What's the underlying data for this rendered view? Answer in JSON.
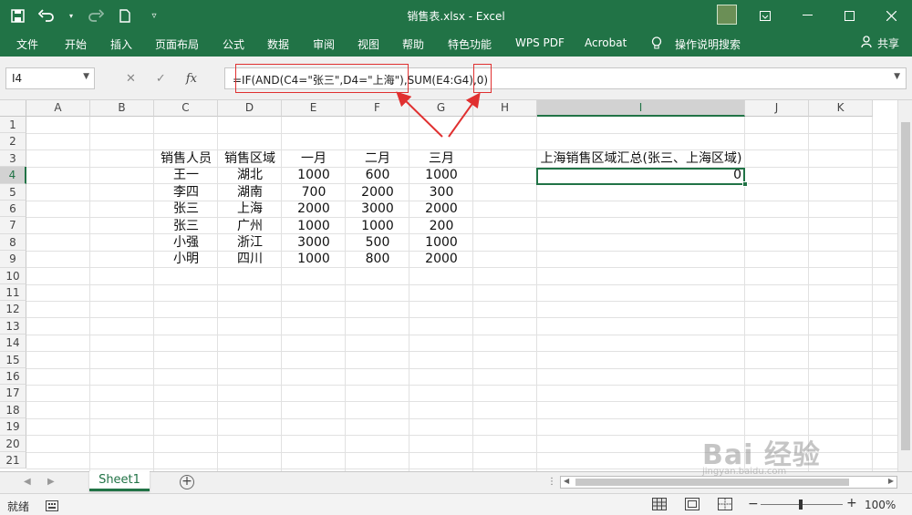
{
  "window": {
    "title": "销售表.xlsx  -  Excel"
  },
  "ribbon": {
    "tabs": [
      "文件",
      "开始",
      "插入",
      "页面布局",
      "公式",
      "数据",
      "审阅",
      "视图",
      "帮助",
      "特色功能",
      "WPS PDF",
      "Acrobat"
    ],
    "search": "操作说明搜索",
    "share": "共享"
  },
  "formula_bar": {
    "name_box": "I4",
    "formula": "=IF(AND(C4=\"张三\",D4=\"上海\"),SUM(E4:G4),0)"
  },
  "grid": {
    "columns": [
      "A",
      "B",
      "C",
      "D",
      "E",
      "F",
      "G",
      "H",
      "I",
      "J",
      "K"
    ],
    "rows": [
      "1",
      "2",
      "3",
      "4",
      "5",
      "6",
      "7",
      "8",
      "9",
      "10",
      "11",
      "12",
      "13",
      "14",
      "15",
      "16",
      "17",
      "18",
      "19",
      "20",
      "21"
    ],
    "header_row": [
      "销售人员",
      "销售区域",
      "一月",
      "二月",
      "三月"
    ],
    "data_rows": [
      [
        "王一",
        "湖北",
        "1000",
        "600",
        "1000"
      ],
      [
        "李四",
        "湖南",
        "700",
        "2000",
        "300"
      ],
      [
        "张三",
        "上海",
        "2000",
        "3000",
        "2000"
      ],
      [
        "张三",
        "广州",
        "1000",
        "1000",
        "200"
      ],
      [
        "小强",
        "浙江",
        "3000",
        "500",
        "1000"
      ],
      [
        "小明",
        "四川",
        "1000",
        "800",
        "2000"
      ]
    ],
    "summary_label": "上海销售区域汇总(张三、上海区域)",
    "summary_value": "0"
  },
  "sheets": {
    "active": "Sheet1"
  },
  "status": {
    "mode": "就绪",
    "zoom": "100%"
  },
  "watermark": {
    "brand": "Bai 经验",
    "url": "jingyan.baidu.com"
  },
  "colors": {
    "accent": "#217346",
    "annotation": "#e03030"
  }
}
